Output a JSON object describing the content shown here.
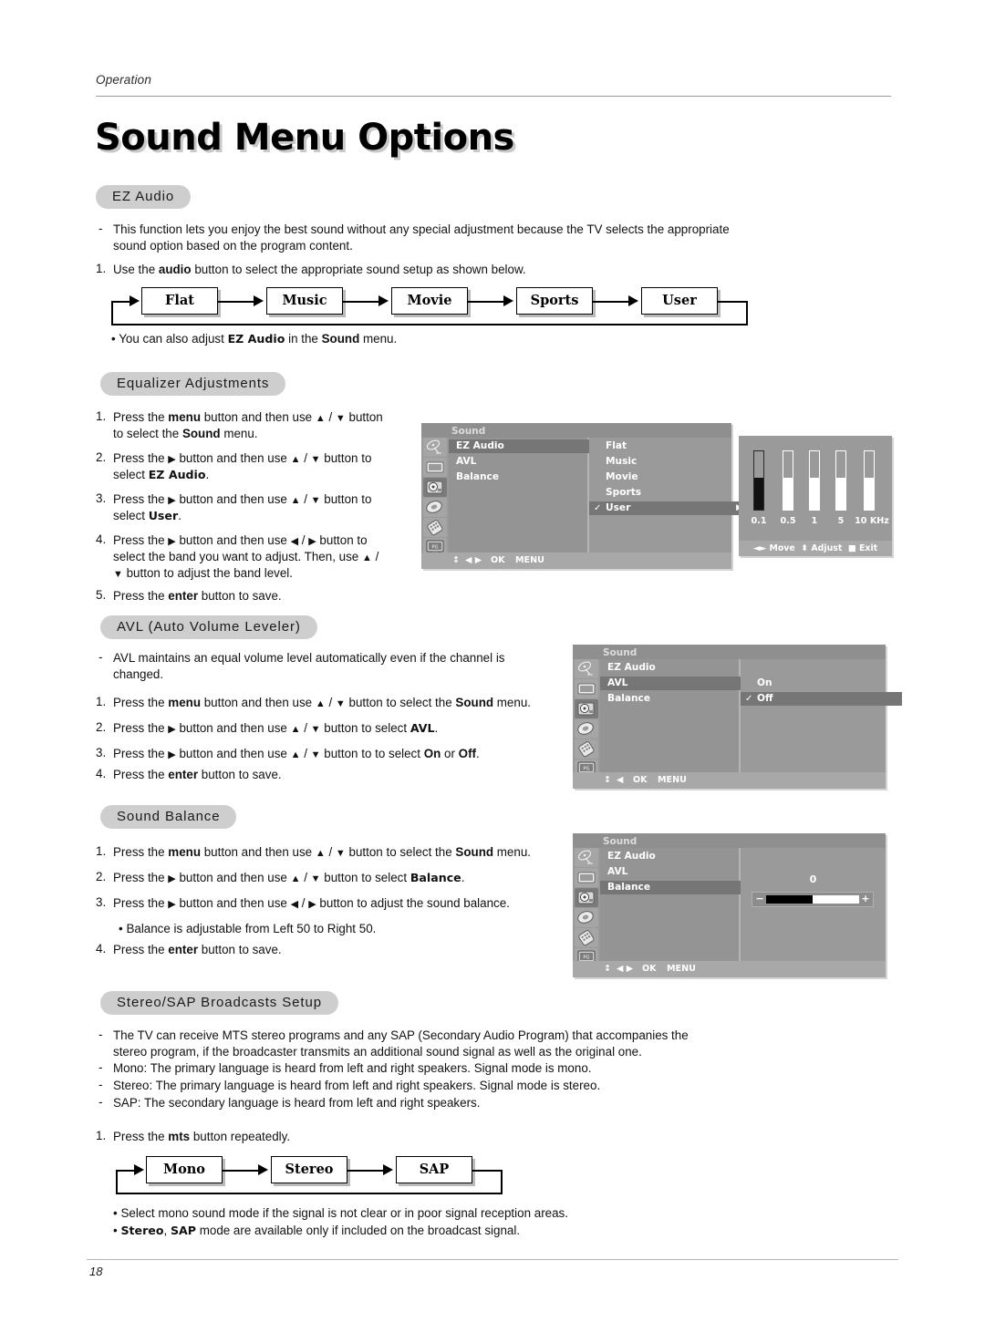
{
  "header": {
    "running_head": "Operation",
    "title": "Sound Menu Options"
  },
  "footer": {
    "page_number": "18"
  },
  "sections": {
    "ez_audio": {
      "heading": "EZ Audio",
      "desc_marker": "-",
      "desc_line1": "This function lets you enjoy the best sound without any special adjustment because the TV selects the appropriate",
      "desc_line2": "sound option based on the program content.",
      "step1_num": "1.",
      "step1_a": "Use the ",
      "step1_b": "audio",
      "step1_c": " button to select the appropriate sound setup as shown below.",
      "note_bullet": "•",
      "note_a": "You can also adjust ",
      "note_b": "EZ Audio",
      "note_c": " in the ",
      "note_d": "Sound",
      "note_e": " menu.",
      "flow": [
        "Flat",
        "Music",
        "Movie",
        "Sports",
        "User"
      ]
    },
    "equalizer": {
      "heading": "Equalizer Adjustments",
      "steps": [
        {
          "num": "1.",
          "line1": "Press the menu button and then use ▲ / ▼  button",
          "line2": "to select the Sound menu."
        },
        {
          "num": "2.",
          "line1": "Press the ▶  button and then use ▲ / ▼ button to",
          "line2": "select EZ Audio."
        },
        {
          "num": "3.",
          "line1": "Press the ▶  button and then use ▲ / ▼ button to",
          "line2": "select User."
        },
        {
          "num": "4.",
          "line1": "Press the ▶  button and then use ◀ / ▶ button to",
          "line2": "select the band you want to adjust. Then, use ▲ /",
          "line3": "▼ button to adjust the band level."
        },
        {
          "num": "5.",
          "line1": "Press the enter button to save."
        }
      ]
    },
    "avl": {
      "heading": "AVL (Auto Volume Leveler)",
      "desc_marker": "-",
      "desc_line1": "AVL maintains an equal volume level automatically even if the channel is",
      "desc_line2": "changed.",
      "steps": [
        {
          "num": "1.",
          "text": "Press the menu button and then use ▲ / ▼  button to select the Sound menu."
        },
        {
          "num": "2.",
          "text": "Press the ▶  button and then use ▲ / ▼ button to select AVL."
        },
        {
          "num": "3.",
          "text": "Press the ▶  button and then use ▲ / ▼ button to to select On or Off."
        },
        {
          "num": "4.",
          "text": "Press the enter button to save."
        }
      ]
    },
    "balance": {
      "heading": "Sound Balance",
      "steps": [
        {
          "num": "1.",
          "text": "Press the menu button and then use ▲ / ▼  button to select the Sound menu."
        },
        {
          "num": "2.",
          "text": "Press the ▶  button and then use ▲ / ▼ button to select Balance."
        },
        {
          "num": "3.",
          "text": "Press the ▶  button and then use ◀ / ▶ button to adjust the sound balance."
        }
      ],
      "note_bullet": "•",
      "note": "Balance is adjustable from Left 50 to Right 50.",
      "step4_num": "4.",
      "step4_text": "Press the enter button to save."
    },
    "stereo_sap": {
      "heading": "Stereo/SAP Broadcasts Setup",
      "desc": [
        {
          "marker": "-",
          "line1": "The TV can receive MTS stereo programs and any SAP (Secondary Audio Program) that accompanies the",
          "line2": "stereo program, if the broadcaster transmits an additional sound signal as well as the original one."
        },
        {
          "marker": "-",
          "line1": "Mono: The primary language is heard from left and right speakers. Signal mode is mono."
        },
        {
          "marker": "-",
          "line1": "Stereo: The primary language is heard from left and right speakers. Signal mode is stereo."
        },
        {
          "marker": "-",
          "line1": "SAP: The secondary language is heard from left and right speakers."
        }
      ],
      "step1_num": "1.",
      "step1_a": "Press the ",
      "step1_b": "mts",
      "step1_c": " button repeatedly.",
      "flow": [
        "Mono",
        "Stereo",
        "SAP"
      ],
      "note1_bullet": "•",
      "note1": "Select mono sound mode if the signal is not clear or in poor signal reception areas.",
      "note2_bullet": "•",
      "note2_a": "Stereo",
      "note2_b": ", ",
      "note2_c": "SAP",
      "note2_d": " mode are available only if included on the broadcast signal."
    }
  },
  "osd_equalizer": {
    "title": "Sound",
    "menu_items": [
      {
        "label": "EZ Audio",
        "selected": true
      },
      {
        "label": "AVL",
        "selected": false
      },
      {
        "label": "Balance",
        "selected": false
      }
    ],
    "options": [
      {
        "label": "Flat",
        "checked": false,
        "selected": false
      },
      {
        "label": "Music",
        "checked": false,
        "selected": false
      },
      {
        "label": "Movie",
        "checked": false,
        "selected": false
      },
      {
        "label": "Sports",
        "checked": false,
        "selected": false
      },
      {
        "label": "User",
        "checked": true,
        "selected": true,
        "caret": "▶"
      }
    ],
    "check_glyph": "✓",
    "footer": {
      "updown": "↕",
      "leftright": "◀ ▶",
      "ok": "OK",
      "menu": "MENU"
    },
    "icons": [
      "antenna-icon",
      "picture-icon",
      "sound-icon",
      "timer-icon",
      "option-icon",
      "lock-icon"
    ],
    "selected_icon_index": 2
  },
  "osd_avl": {
    "title": "Sound",
    "menu_items": [
      {
        "label": "EZ Audio",
        "selected": false
      },
      {
        "label": "AVL",
        "selected": true
      },
      {
        "label": "Balance",
        "selected": false
      }
    ],
    "options": [
      {
        "label": "On",
        "checked": false,
        "selected": false
      },
      {
        "label": "Off",
        "checked": true,
        "selected": true
      }
    ],
    "check_glyph": "✓",
    "footer": {
      "updown": "↕",
      "leftright": "◀",
      "ok": "OK",
      "menu": "MENU"
    }
  },
  "osd_balance": {
    "title": "Sound",
    "menu_items": [
      {
        "label": "EZ Audio",
        "selected": false
      },
      {
        "label": "AVL",
        "selected": false
      },
      {
        "label": "Balance",
        "selected": true
      }
    ],
    "footer": {
      "updown": "↕",
      "leftright": "◀ ▶",
      "ok": "OK",
      "menu": "MENU"
    }
  },
  "chart_data": {
    "type": "bar",
    "title": "Equalizer Adjustments",
    "categories": [
      "0.1",
      "0.5",
      "1",
      "5",
      "10 KHz"
    ],
    "values": [
      55,
      55,
      55,
      55,
      55
    ],
    "ylim": [
      0,
      100
    ],
    "xlabel": "",
    "ylabel": "",
    "grid": false,
    "legend": null,
    "selected_index": 0,
    "annotations": [
      "◀▶ Move",
      "↕ Adjust",
      "■ Exit"
    ],
    "footer_move": "Move",
    "footer_adjust": "Adjust",
    "footer_exit": "Exit"
  },
  "balance_control": {
    "value": "0",
    "fill_percent": 50,
    "minus": "−",
    "plus": "+"
  }
}
